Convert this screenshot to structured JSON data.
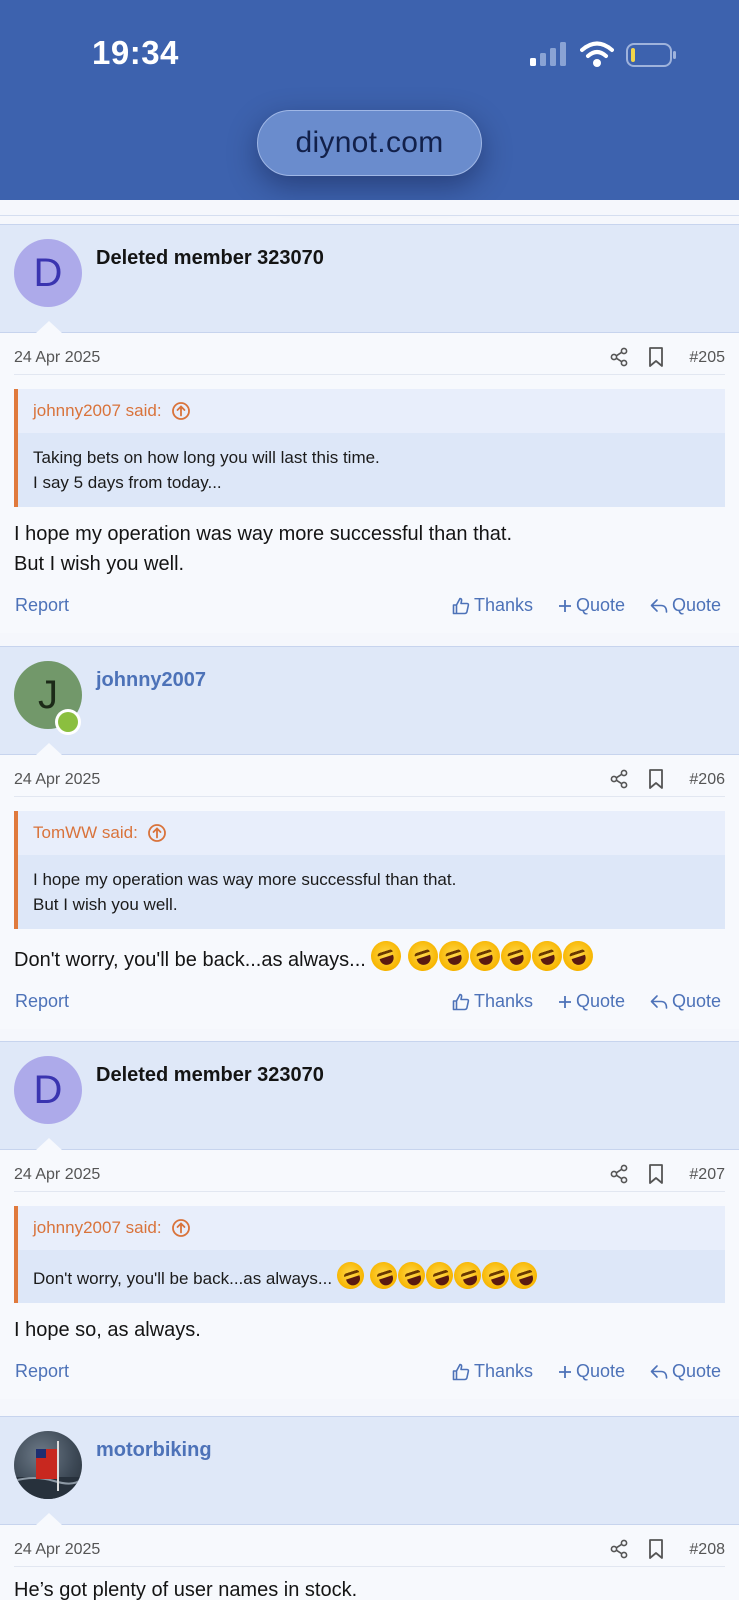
{
  "status": {
    "time": "19:34"
  },
  "browser": {
    "url": "diynot.com"
  },
  "posts": [
    {
      "username": "Deleted member 323070",
      "avatar_letter": "D",
      "date": "24 Apr 2025",
      "number": "#205",
      "quote_author": "johnny2007 said:",
      "quote_lines": [
        "Taking bets on how long you will last this time.",
        "I say 5 days from today..."
      ],
      "body_lines": [
        "I hope my operation was way more successful than that.",
        "But I wish you well."
      ]
    },
    {
      "username": "johnny2007",
      "avatar_letter": "J",
      "date": "24 Apr 2025",
      "number": "#206",
      "quote_author": "TomWW said:",
      "quote_lines": [
        "I hope my operation was way more successful than that.",
        "But I wish you well."
      ],
      "body_lines": [
        "Don't worry, you'll be back...as always..."
      ]
    },
    {
      "username": "Deleted member 323070",
      "avatar_letter": "D",
      "date": "24 Apr 2025",
      "number": "#207",
      "quote_author": "johnny2007 said:",
      "quote_lines": [
        "Don't worry, you'll be back...as always..."
      ],
      "body_lines": [
        "I hope so, as always."
      ]
    },
    {
      "username": "motorbiking",
      "date": "24 Apr 2025",
      "number": "#208",
      "body_lines": [
        "He’s got plenty of user names in stock."
      ]
    }
  ],
  "actions": {
    "report": "Report",
    "thanks": "Thanks",
    "multi_quote": "Quote",
    "quote": "Quote"
  },
  "icons": [
    "signal-icon",
    "wifi-icon",
    "battery-icon",
    "share-icon",
    "bookmark-icon",
    "arrow-up-circle-icon",
    "thumbs-up-icon",
    "plus-icon",
    "reply-icon",
    "laughing-emoji-icon"
  ],
  "colors": {
    "header": "#3d62ae",
    "link": "#4d72b8",
    "quote_accent": "#e07a3d",
    "online": "#8bbf3f"
  }
}
